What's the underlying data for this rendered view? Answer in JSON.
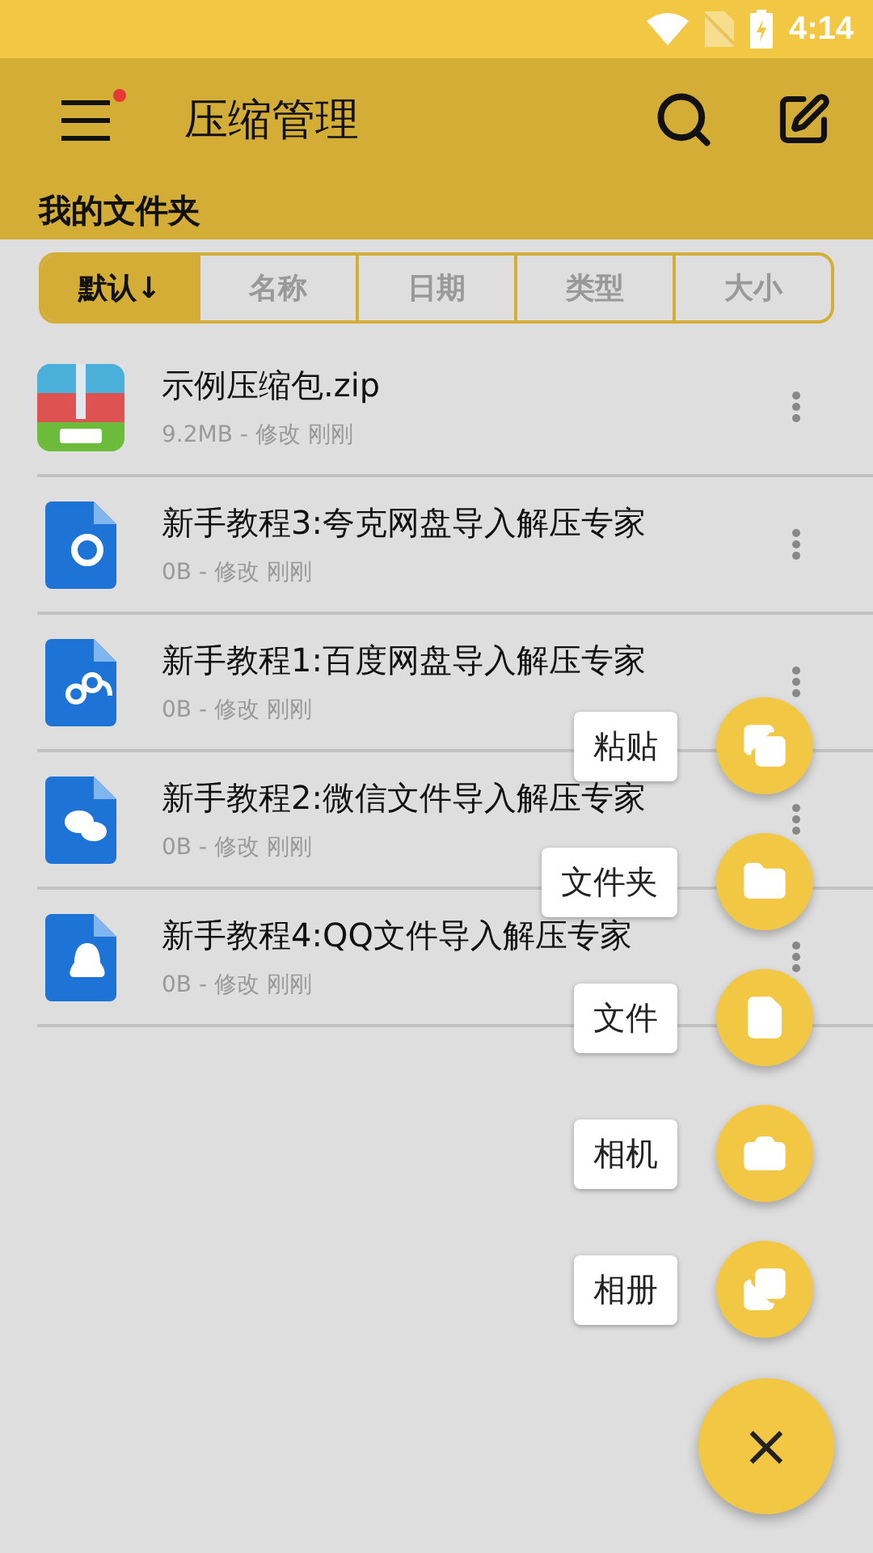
{
  "status_bar": {
    "time": "4:14"
  },
  "app_bar": {
    "title": "压缩管理",
    "menu_badge": true
  },
  "section_title": "我的文件夹",
  "sort_tabs": [
    {
      "label": "默认↓",
      "selected": true
    },
    {
      "label": "名称",
      "selected": false
    },
    {
      "label": "日期",
      "selected": false
    },
    {
      "label": "类型",
      "selected": false
    },
    {
      "label": "大小",
      "selected": false
    }
  ],
  "files": [
    {
      "kind": "zip",
      "name": "示例压缩包.zip",
      "meta": "9.2MB - 修改 刚刚"
    },
    {
      "kind": "quark",
      "name": "新手教程3:夸克网盘导入解压专家",
      "meta": "0B - 修改 刚刚"
    },
    {
      "kind": "baidu",
      "name": "新手教程1:百度网盘导入解压专家",
      "meta": "0B - 修改 刚刚"
    },
    {
      "kind": "wechat",
      "name": "新手教程2:微信文件导入解压专家",
      "meta": "0B - 修改 刚刚"
    },
    {
      "kind": "qq",
      "name": "新手教程4:QQ文件导入解压专家",
      "meta": "0B - 修改 刚刚"
    }
  ],
  "fab_actions": [
    {
      "kind": "paste",
      "label": "粘贴"
    },
    {
      "kind": "folder",
      "label": "文件夹"
    },
    {
      "kind": "file",
      "label": "文件"
    },
    {
      "kind": "camera",
      "label": "相机"
    },
    {
      "kind": "gallery",
      "label": "相册"
    }
  ],
  "fab_close": "×"
}
